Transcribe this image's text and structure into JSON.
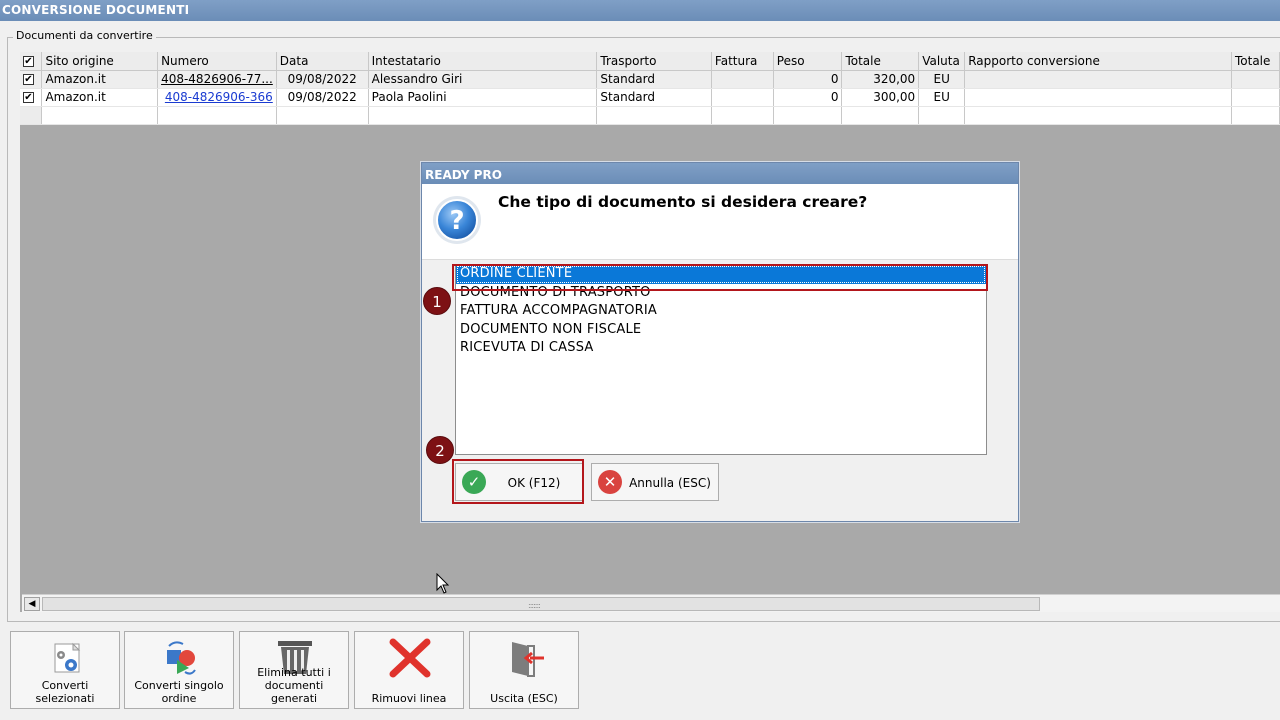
{
  "window": {
    "title": "CONVERSIONE DOCUMENTI"
  },
  "group": {
    "label": "Documenti da convertire"
  },
  "grid": {
    "columns": [
      "Sito origine",
      "Numero",
      "Data",
      "Intestatario",
      "Trasporto",
      "Fattura",
      "Peso",
      "Totale",
      "Valuta",
      "Rapporto conversione",
      "Totale"
    ],
    "rows": [
      {
        "checked": true,
        "sito": "Amazon.it",
        "numero": "408-4826906-77...",
        "data": "09/08/2022",
        "intestatario": "Alessandro Giri",
        "trasporto": "Standard",
        "fattura": "",
        "peso": "0",
        "totale": "320,00",
        "valuta": "EU",
        "rapporto": "",
        "totale2": ""
      },
      {
        "checked": true,
        "sito": "Amazon.it",
        "numero": "408-4826906-366",
        "data": "09/08/2022",
        "intestatario": "Paola Paolini",
        "trasporto": "Standard",
        "fattura": "",
        "peso": "0",
        "totale": "300,00",
        "valuta": "EU",
        "rapporto": "",
        "totale2": ""
      }
    ]
  },
  "dialog": {
    "title": "READY PRO",
    "question": "Che tipo di documento si desidera creare?",
    "options": [
      "ORDINE CLIENTE",
      "DOCUMENTO DI TRASPORTO",
      "FATTURA ACCOMPAGNATORIA",
      "DOCUMENTO NON FISCALE",
      "RICEVUTA DI CASSA"
    ],
    "selected_option": "ORDINE CLIENTE",
    "ok_label": "OK (F12)",
    "cancel_label": "Annulla (ESC)"
  },
  "callouts": {
    "step1": "1",
    "step2": "2"
  },
  "toolbar": {
    "buttons": [
      {
        "label": "Converti selezionati",
        "icon": "convert-gear-icon"
      },
      {
        "label": "Converti singolo ordine",
        "icon": "convert-single-icon"
      },
      {
        "label": "Elimina tutti i documenti generati",
        "icon": "trash-icon"
      },
      {
        "label": "Rimuovi linea",
        "icon": "red-x-icon"
      },
      {
        "label": "Uscita (ESC)",
        "icon": "exit-door-icon"
      }
    ]
  },
  "colors": {
    "title_bar": "#7393bd",
    "selection": "#0a78d8",
    "callout": "#b3161b",
    "badge": "#7d1114",
    "link": "#1a3bd1"
  }
}
